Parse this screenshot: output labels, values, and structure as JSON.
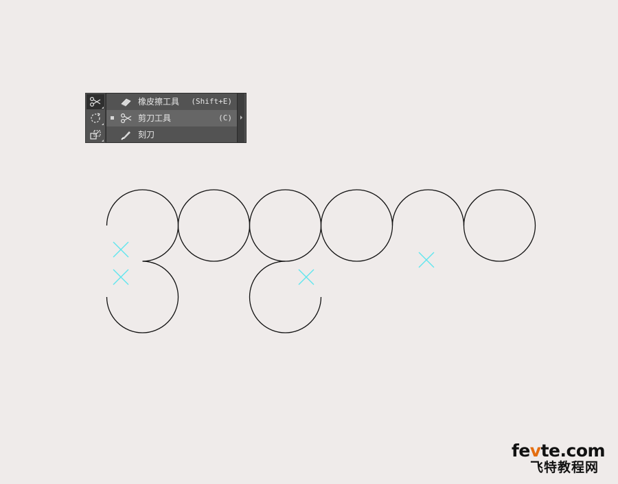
{
  "toolbar": {
    "tools": [
      {
        "icon": "scissors-icon",
        "active": true
      },
      {
        "icon": "rotate-icon",
        "active": false
      },
      {
        "icon": "scale-icon",
        "active": false
      }
    ]
  },
  "flyout": {
    "items": [
      {
        "label": "橡皮擦工具",
        "shortcut": "(Shift+E)",
        "icon": "eraser-icon",
        "selected": false
      },
      {
        "label": "剪刀工具",
        "shortcut": "(C)",
        "icon": "scissors-icon",
        "selected": true
      },
      {
        "label": "刻刀",
        "shortcut": "",
        "icon": "knife-icon",
        "selected": false
      }
    ]
  },
  "colors": {
    "canvas_bg": "#efebea",
    "stroke": "#111111",
    "cut_marker": "#5ee6ee",
    "panel_bg": "#535353",
    "watermark_accent": "#e46d0f"
  },
  "watermark": {
    "domain_pre": "fe",
    "domain_accent": "v",
    "domain_post": "te.com",
    "subtitle": "飞特教程网"
  }
}
